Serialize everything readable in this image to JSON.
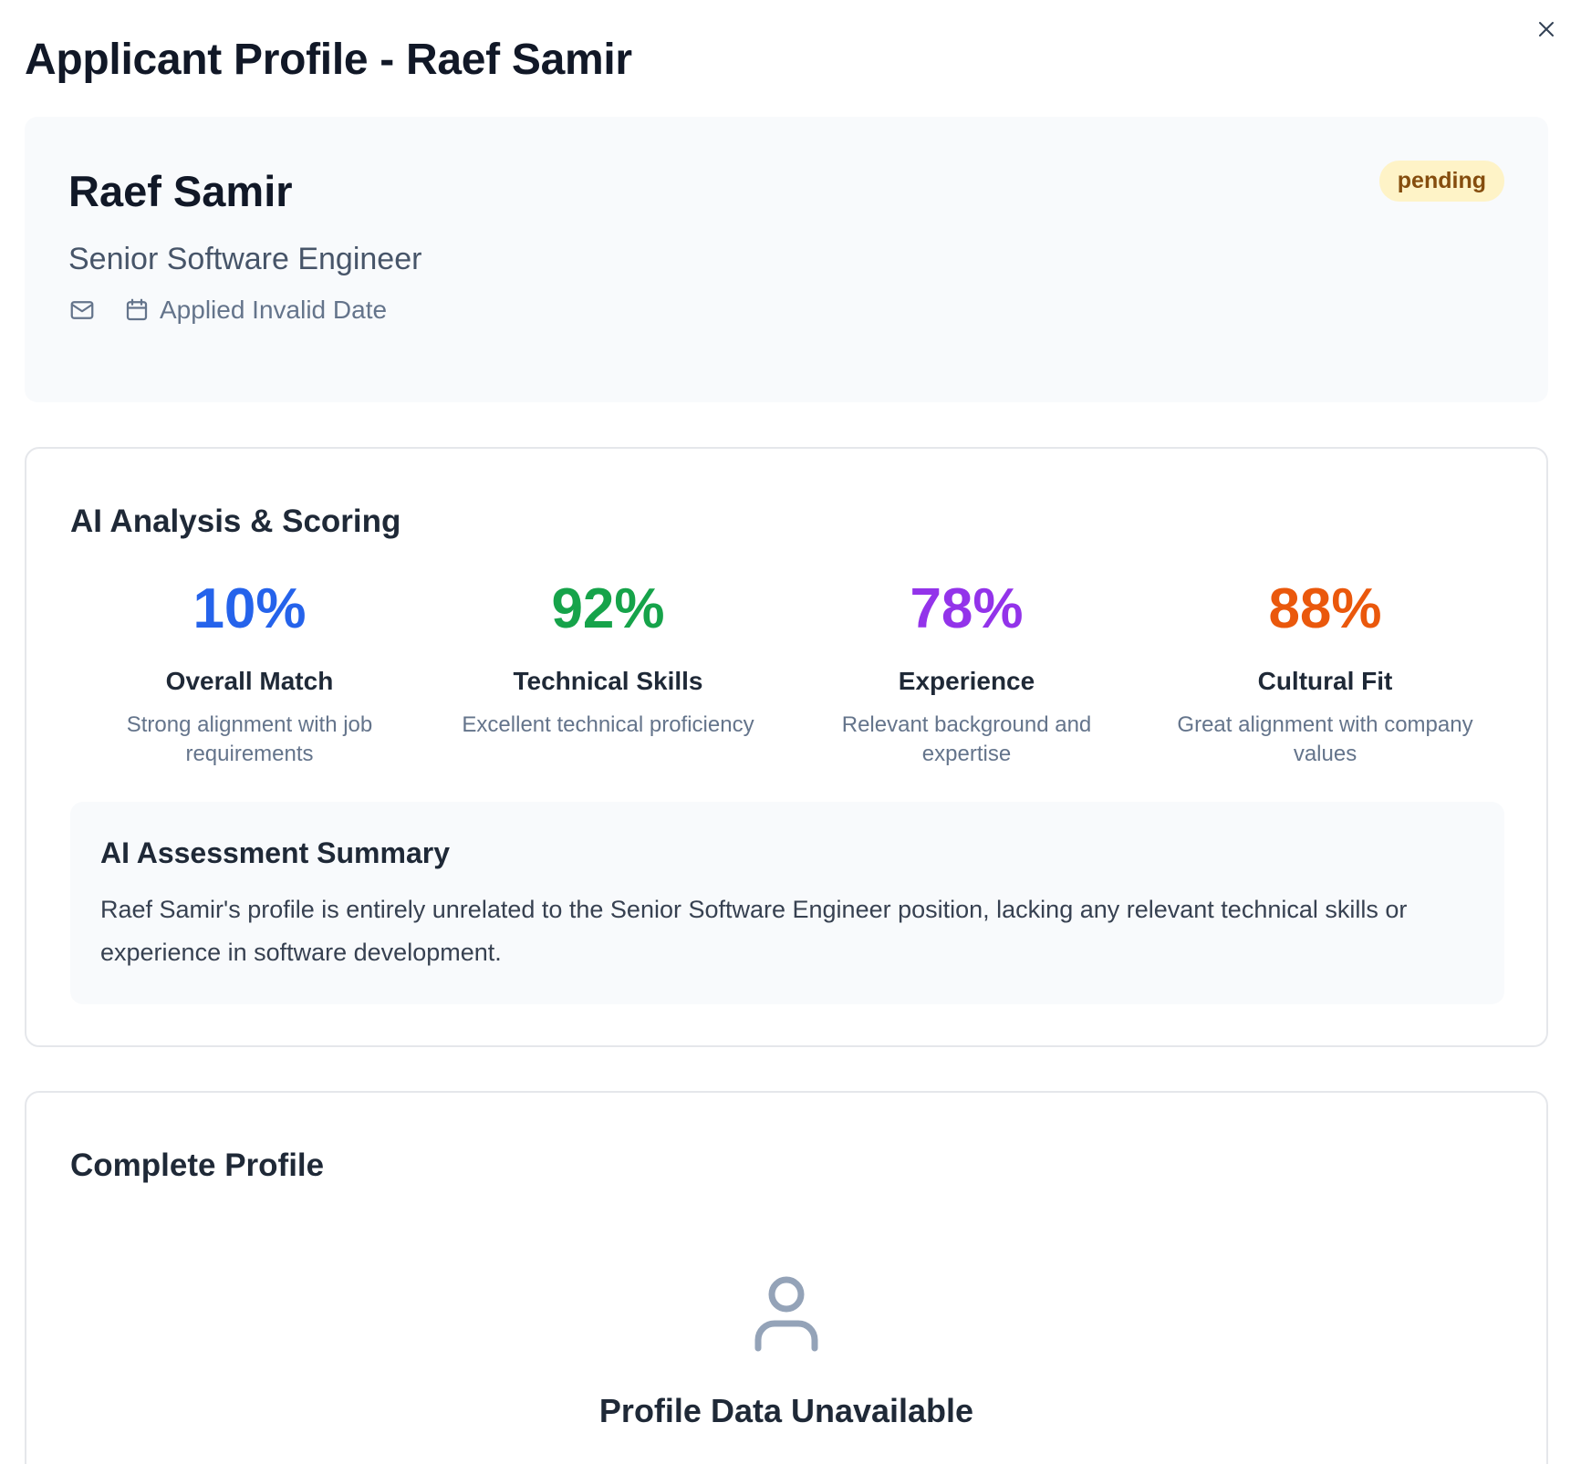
{
  "dialog": {
    "title": "Applicant Profile - Raef Samir",
    "close_icon": "close-icon"
  },
  "applicant": {
    "name": "Raef Samir",
    "role": "Senior Software Engineer",
    "applied": "Applied Invalid Date",
    "status": "pending",
    "email_icon": "mail-icon",
    "date_icon": "calendar-icon"
  },
  "analysis": {
    "title": "AI Analysis & Scoring",
    "scores": [
      {
        "value": "10%",
        "label": "Overall Match",
        "desc": "Strong alignment with job requirements",
        "color": "#2563eb"
      },
      {
        "value": "92%",
        "label": "Technical Skills",
        "desc": "Excellent technical proficiency",
        "color": "#16a34a"
      },
      {
        "value": "78%",
        "label": "Experience",
        "desc": "Relevant background and expertise",
        "color": "#9333ea"
      },
      {
        "value": "88%",
        "label": "Cultural Fit",
        "desc": "Great alignment with company values",
        "color": "#ea580c"
      }
    ],
    "summary_title": "AI Assessment Summary",
    "summary_text": "Raef Samir's profile is entirely unrelated to the Senior Software Engineer position, lacking any relevant technical skills or experience in software development."
  },
  "profile": {
    "title": "Complete Profile",
    "empty_title": "Profile Data Unavailable",
    "empty_icon": "user-icon"
  },
  "colors": {
    "badge_bg": "#fef3c7",
    "badge_text": "#854d0e",
    "card_bg": "#f8fafc"
  }
}
